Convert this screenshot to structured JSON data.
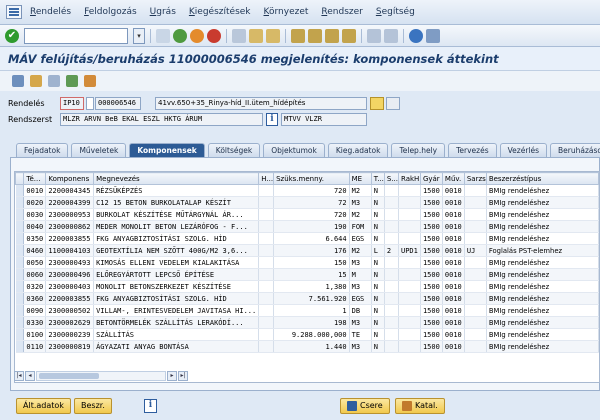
{
  "menu": [
    "Rendelés",
    "Feldolgozás",
    "Ugrás",
    "Kiegészítések",
    "Környezet",
    "Rendszer",
    "Segítség"
  ],
  "menu_underline": [
    "R",
    "F",
    "U",
    "K",
    "K",
    "R",
    "S"
  ],
  "title": "MÁV felújítás/beruházás 11000006546 megjelenítés: komponensek áttekint",
  "header": {
    "order_label": "Rendelés",
    "order_type": "IP10",
    "order_number": "000006546",
    "order_text": "41vv.650+35_Rinya-híd_II.ütem_hídépítés",
    "system_status_label": "Rendszerst",
    "system_status": "MLZR ARVN BeB  EKAL ESZL HKTG ÁRUM",
    "user_status": "MTVV VLZR"
  },
  "tabs": [
    "Fejadatok",
    "Műveletek",
    "Komponensek",
    "Költségek",
    "Objektumok",
    "Kieg.adatok",
    "Telep.hely",
    "Tervezés",
    "Vezérlés",
    "Beruházások"
  ],
  "active_tab": "Komponensek",
  "columns": [
    "Té...",
    "Komponens",
    "Megnevezés",
    "H...",
    "Szüks.menny.",
    "ME",
    "T...",
    "S...",
    "RakH",
    "Gyár",
    "Műv.",
    "Sarzs",
    "Beszerzéstípus"
  ],
  "rows": [
    [
      "0010",
      "2200004345",
      "RÉZSŰKÉPZÉS",
      "",
      "720",
      "M2",
      "N",
      "",
      "",
      "1500",
      "0010",
      "",
      "BMIg rendeléshez"
    ],
    [
      "0020",
      "2200004399",
      "C12 15 BETON BURKOLATALAP KÉSZÍT",
      "",
      "72",
      "M3",
      "N",
      "",
      "",
      "1500",
      "0010",
      "",
      "BMIg rendeléshez"
    ],
    [
      "0030",
      "2300000953",
      "BURKOLAT KÉSZÍTÉSE MŰTÁRGYNÁL ÁR...",
      "",
      "720",
      "M2",
      "N",
      "",
      "",
      "1500",
      "0010",
      "",
      "BMIg rendeléshez"
    ],
    [
      "0040",
      "2300000862",
      "MEDER MONOLIT BETON LEZÁRÓFOG - F...",
      "",
      "190",
      "FOM",
      "N",
      "",
      "",
      "1500",
      "0010",
      "",
      "BMIg rendeléshez"
    ],
    [
      "0350",
      "2200003855",
      "FKG ANYAGBIZTOSÍTÁSI SZOLG. HÍD",
      "",
      "6.644",
      "EGS",
      "N",
      "",
      "",
      "1500",
      "0010",
      "",
      "BMIg rendeléshez"
    ],
    [
      "0460",
      "1100004103",
      "GEOTEXTÍLIA NEM SZŐTT 400G/M2 3,6...",
      "",
      "176",
      "M2",
      "L",
      "2",
      "UPD1",
      "1500",
      "0010",
      "UJ",
      "Foglalás PST-elemhez"
    ],
    [
      "0050",
      "2300000493",
      "KIMOSÁS ELLENI VEDELEM KIALAKITÁSA",
      "",
      "150",
      "M3",
      "N",
      "",
      "",
      "1500",
      "0010",
      "",
      "BMIg rendeléshez"
    ],
    [
      "0060",
      "2300000496",
      "ELŐREGYÁRTOTT LEPCSŐ ÉPÍTÉSE",
      "",
      "15",
      "M",
      "N",
      "",
      "",
      "1500",
      "0010",
      "",
      "BMIg rendeléshez"
    ],
    [
      "0320",
      "2300000403",
      "MONOLIT BETONSZERKEZET KÉSZÍTÉSE",
      "",
      "1,380",
      "M3",
      "N",
      "",
      "",
      "1500",
      "0010",
      "",
      "BMIg rendeléshez"
    ],
    [
      "0360",
      "2200003855",
      "FKG ANYAGBIZTOSÍTÁSI SZOLG. HÍD",
      "",
      "7.561.920",
      "EGS",
      "N",
      "",
      "",
      "1500",
      "0010",
      "",
      "BMIg rendeléshez"
    ],
    [
      "0090",
      "2300000502",
      "VILLAM-, ERINTESVEDELEM JAVITASA HI...",
      "",
      "1",
      "DB",
      "N",
      "",
      "",
      "1500",
      "0010",
      "",
      "BMIg rendeléshez"
    ],
    [
      "0330",
      "2300002629",
      "BETONTÖRMELÉK SZÁLLÍTÁS LERAKÓDÍ...",
      "",
      "198",
      "M3",
      "N",
      "",
      "",
      "1500",
      "0010",
      "",
      "BMIg rendeléshez"
    ],
    [
      "0100",
      "2300000239",
      "SZÁLLÍTÁS",
      "",
      "9.288.000,000",
      "TE",
      "N",
      "",
      "",
      "1500",
      "0010",
      "",
      "BMIg rendeléshez"
    ],
    [
      "0110",
      "2300000819",
      "ÁGYAZATI ANYAG BONTÁSA",
      "",
      "1.440",
      "M3",
      "N",
      "",
      "",
      "1500",
      "0010",
      "",
      "BMIg rendeléshez"
    ]
  ],
  "buttons": {
    "alt_data": "Ált.adatok",
    "procure": "Beszr.",
    "replace": "Csere",
    "catalog": "Katal."
  },
  "icons": {
    "ok": "✔",
    "info": "i",
    "dropdown": "▾",
    "scroll_left": "◂",
    "scroll_right": "▸",
    "scroll_first": "|◂",
    "scroll_last": "▸|"
  },
  "colors": {
    "active_tab": "#2d5b95",
    "title": "#1b3d6d",
    "button": "#f1c94d",
    "ok_icon": "#2e9b2e"
  }
}
